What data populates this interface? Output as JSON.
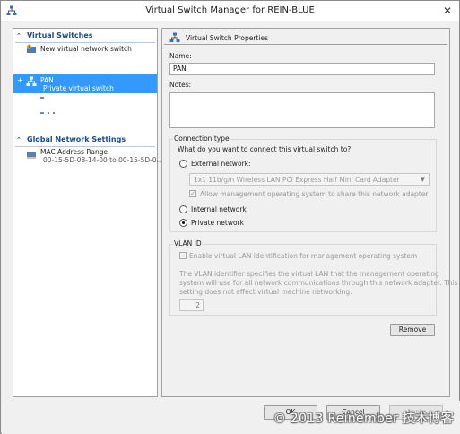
{
  "window": {
    "title": "Virtual Switch Manager for REIN-BLUE",
    "close_glyph": "✕"
  },
  "sidebar": {
    "virtual_switches_heading": "Virtual Switches",
    "global_settings_heading": "Global Network Settings",
    "new_switch_label": "New virtual network switch",
    "selected_switch": {
      "name": "PAN",
      "type": "Private virtual switch",
      "expander": "+"
    },
    "mac_range": {
      "label": "MAC Address Range",
      "value": "00-15-5D-08-14-00 to 00-15-5D-0..."
    }
  },
  "properties": {
    "header": "Virtual Switch Properties",
    "name_label": "Name:",
    "name_value": "PAN",
    "notes_label": "Notes:",
    "notes_value": "",
    "connection_type_title": "Connection type",
    "connection_question": "What do you want to connect this virtual switch to?",
    "external_label": "External network:",
    "adapter_selected": "1x1 11b/g/n Wireless LAN PCI Express Half Mini Card Adapter",
    "allow_mgmt_label": "Allow management operating system to share this network adapter",
    "internal_label": "Internal network",
    "private_label": "Private network",
    "selected_connection": "Private network",
    "vlan_title": "VLAN ID",
    "vlan_enable_label": "Enable virtual LAN identification for management operating system",
    "vlan_description": [
      "The VLAN identifier specifies the virtual LAN that the management operating",
      "system will use for all network communications through this network adapter. This",
      "setting does not affect virtual machine networking."
    ],
    "vlan_value": "2",
    "remove_label": "Remove"
  },
  "footer": {
    "ok_label": "OK",
    "cancel_label": "Cancel",
    "apply_label": "Apply",
    "watermark": "© 2013 Reinember 技术博客"
  },
  "colors": {
    "selection": "#3399ff",
    "heading": "#1a4c8c"
  }
}
